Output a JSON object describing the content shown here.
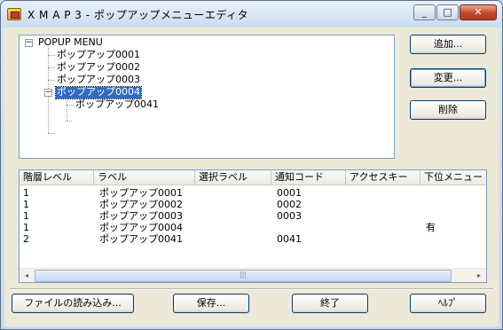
{
  "window": {
    "title": "X M A P 3 - ポップアップメニューエディタ",
    "minimize": "_",
    "maximize": "□",
    "close": "✕"
  },
  "tree": {
    "root": {
      "label": "POPUP MENU",
      "expander": "−"
    },
    "items": [
      {
        "label": "ポップアップ0001"
      },
      {
        "label": "ポップアップ0002"
      },
      {
        "label": "ポップアップ0003"
      },
      {
        "label": "ポップアップ0004",
        "expander": "−",
        "selected": true,
        "children": [
          {
            "label": "ポップアップ0041"
          }
        ]
      }
    ]
  },
  "side_buttons": {
    "add": "追加...",
    "change": "変更...",
    "delete": "削除"
  },
  "list": {
    "columns": [
      "階層レベル",
      "ラベル",
      "選択ラベル",
      "通知コード",
      "アクセスキー",
      "下位メニュー"
    ],
    "rows": [
      [
        "1",
        "ポップアップ0001",
        "",
        "0001",
        "",
        ""
      ],
      [
        "1",
        "ポップアップ0002",
        "",
        "0002",
        "",
        ""
      ],
      [
        "1",
        "ポップアップ0003",
        "",
        "0003",
        "",
        ""
      ],
      [
        "1",
        "ポップアップ0004",
        "",
        "",
        "",
        "有"
      ],
      [
        "2",
        "ポップアップ0041",
        "",
        "0041",
        "",
        ""
      ]
    ],
    "scroll_left": "◂",
    "scroll_right": "▸",
    "thumb_grip": "|||"
  },
  "bottom_buttons": {
    "load": "ファイルの読み込み...",
    "save": "保存...",
    "exit": "終了",
    "help": "ﾍﾙﾌﾟ"
  }
}
